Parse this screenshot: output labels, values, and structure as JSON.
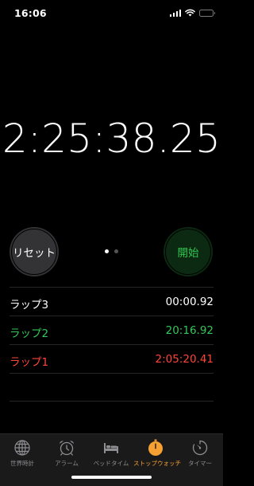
{
  "status_bar": {
    "time": "16:06",
    "battery_color": "#34c759"
  },
  "stopwatch": {
    "elapsed": "2:25:38.25"
  },
  "controls": {
    "reset_label": "リセット",
    "start_label": "開始",
    "page_count": 2,
    "active_page": 1
  },
  "laps": [
    {
      "label": "ラップ3",
      "time": "00:00.92",
      "color": "#ffffff"
    },
    {
      "label": "ラップ2",
      "time": "20:16.92",
      "color": "#34c759"
    },
    {
      "label": "ラップ1",
      "time": "2:05:20.41",
      "color": "#ff453a"
    }
  ],
  "tabs": [
    {
      "label": "世界時計",
      "icon": "globe-icon",
      "active": false
    },
    {
      "label": "アラーム",
      "icon": "alarm-clock-icon",
      "active": false
    },
    {
      "label": "ベッドタイム",
      "icon": "bed-icon",
      "active": false
    },
    {
      "label": "ストップウォッチ",
      "icon": "stopwatch-icon",
      "active": true
    },
    {
      "label": "タイマー",
      "icon": "timer-icon",
      "active": false
    }
  ],
  "colors": {
    "background": "#000000",
    "accent": "#f7a133",
    "start_green": "#31c552",
    "lap_best": "#34c759",
    "lap_worst": "#ff453a",
    "inactive_tab": "#8e8e93"
  }
}
